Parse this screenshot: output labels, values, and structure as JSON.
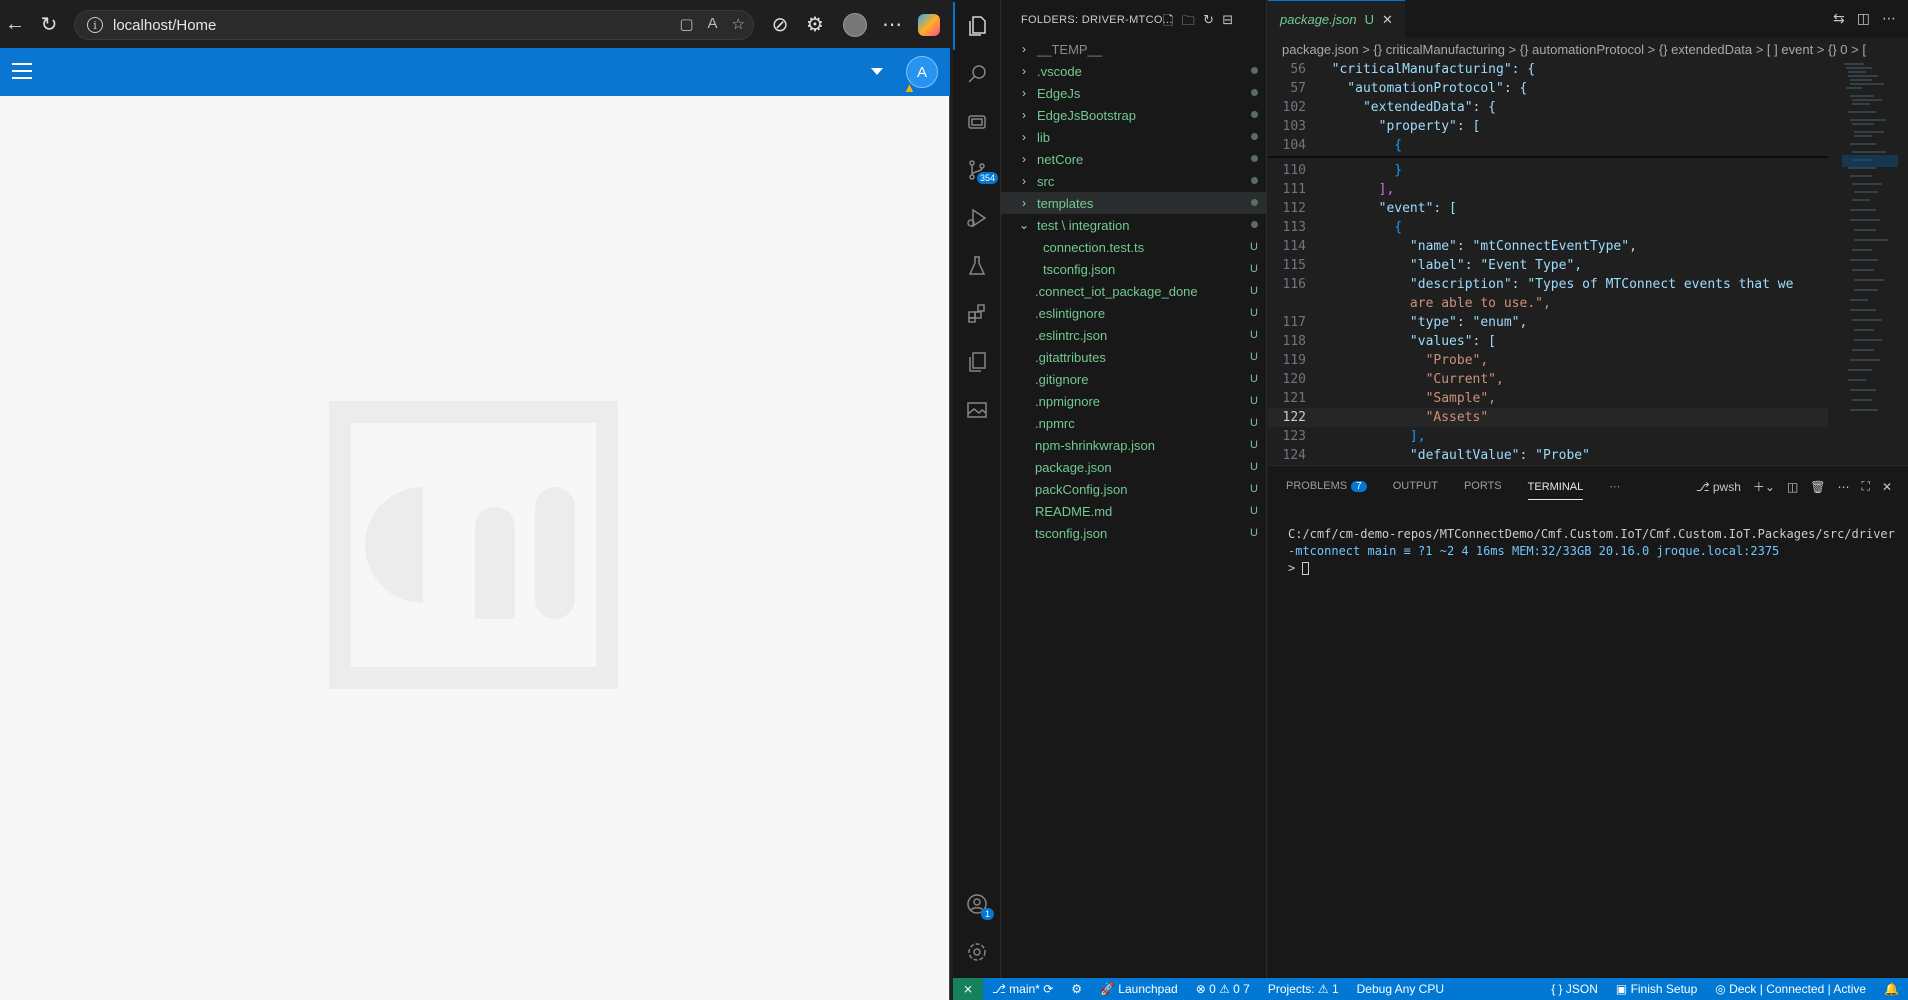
{
  "browser": {
    "url": "localhost/Home",
    "avatar_letter": "A"
  },
  "explorer": {
    "header": "FOLDERS: DRIVER-MTCO...",
    "items": [
      {
        "label": "__TEMP__",
        "status": ""
      },
      {
        "label": ".vscode",
        "status": ""
      },
      {
        "label": "EdgeJs",
        "status": ""
      },
      {
        "label": "EdgeJsBootstrap",
        "status": ""
      },
      {
        "label": "lib",
        "status": ""
      },
      {
        "label": "netCore",
        "status": ""
      },
      {
        "label": "src",
        "status": ""
      },
      {
        "label": "templates",
        "status": ""
      },
      {
        "label": "test \\ integration",
        "status": ""
      },
      {
        "label": "connection.test.ts",
        "status": "U"
      },
      {
        "label": "tsconfig.json",
        "status": "U"
      },
      {
        "label": ".connect_iot_package_done",
        "status": "U"
      },
      {
        "label": ".eslintignore",
        "status": "U"
      },
      {
        "label": ".eslintrc.json",
        "status": "U"
      },
      {
        "label": ".gitattributes",
        "status": "U"
      },
      {
        "label": ".gitignore",
        "status": "U"
      },
      {
        "label": ".npmignore",
        "status": "U"
      },
      {
        "label": ".npmrc",
        "status": "U"
      },
      {
        "label": "npm-shrinkwrap.json",
        "status": "U"
      },
      {
        "label": "package.json",
        "status": "U"
      },
      {
        "label": "packConfig.json",
        "status": "U"
      },
      {
        "label": "README.md",
        "status": "U"
      },
      {
        "label": "tsconfig.json",
        "status": "U"
      }
    ]
  },
  "activity": {
    "scm_badge": "354",
    "accounts_badge": "1"
  },
  "editor": {
    "tab_label": "package.json",
    "tab_status": "U",
    "breadcrumb": "package.json  >  {} criticalManufacturing  >  {} automationProtocol  >  {} extendedData  >  [ ] event  >  {} 0  >  [",
    "lines": [
      {
        "n": "56",
        "t": "  \"criticalManufacturing\": {"
      },
      {
        "n": "57",
        "t": "    \"automationProtocol\": {"
      },
      {
        "n": "102",
        "t": "      \"extendedData\": {"
      },
      {
        "n": "103",
        "t": "        \"property\": ["
      },
      {
        "n": "104",
        "t": "          {"
      },
      {
        "n": "110",
        "t": "          }"
      },
      {
        "n": "111",
        "t": "        ],"
      },
      {
        "n": "112",
        "t": "        \"event\": ["
      },
      {
        "n": "113",
        "t": "          {"
      },
      {
        "n": "114",
        "t": "            \"name\": \"mtConnectEventType\","
      },
      {
        "n": "115",
        "t": "            \"label\": \"Event Type\","
      },
      {
        "n": "116",
        "t": "            \"description\": \"Types of MTConnect events that we"
      },
      {
        "n": "",
        "t": "            are able to use.\","
      },
      {
        "n": "117",
        "t": "            \"type\": \"enum\","
      },
      {
        "n": "118",
        "t": "            \"values\": ["
      },
      {
        "n": "119",
        "t": "              \"Probe\","
      },
      {
        "n": "120",
        "t": "              \"Current\","
      },
      {
        "n": "121",
        "t": "              \"Sample\","
      },
      {
        "n": "122",
        "t": "              \"Assets\""
      },
      {
        "n": "123",
        "t": "            ],"
      },
      {
        "n": "124",
        "t": "            \"defaultValue\": \"Probe\""
      }
    ]
  },
  "panel": {
    "tabs": [
      "PROBLEMS",
      "OUTPUT",
      "PORTS",
      "TERMINAL"
    ],
    "problems_count": "7",
    "shell": "pwsh",
    "term_line1": "C:/cmf/cm-demo-repos/MTConnectDemo/Cmf.Custom.IoT/Cmf.Custom.IoT.Packages/src/driver",
    "term_line2": "-mtconnect  main ≡  ?1 ~2  4    16ms  MEM:32/33GB  20.16.0  jroque.local:2375",
    "term_prompt": "> "
  },
  "statusbar": {
    "branch": "main*",
    "launchpad": "Launchpad",
    "problems": "⊗ 0 ⚠ 0  7",
    "projects": "Projects: ⚠ 1",
    "debug": "Debug Any CPU",
    "language": "{ } JSON",
    "finish_setup": "Finish Setup",
    "deck": "Deck | Connected | Active"
  }
}
